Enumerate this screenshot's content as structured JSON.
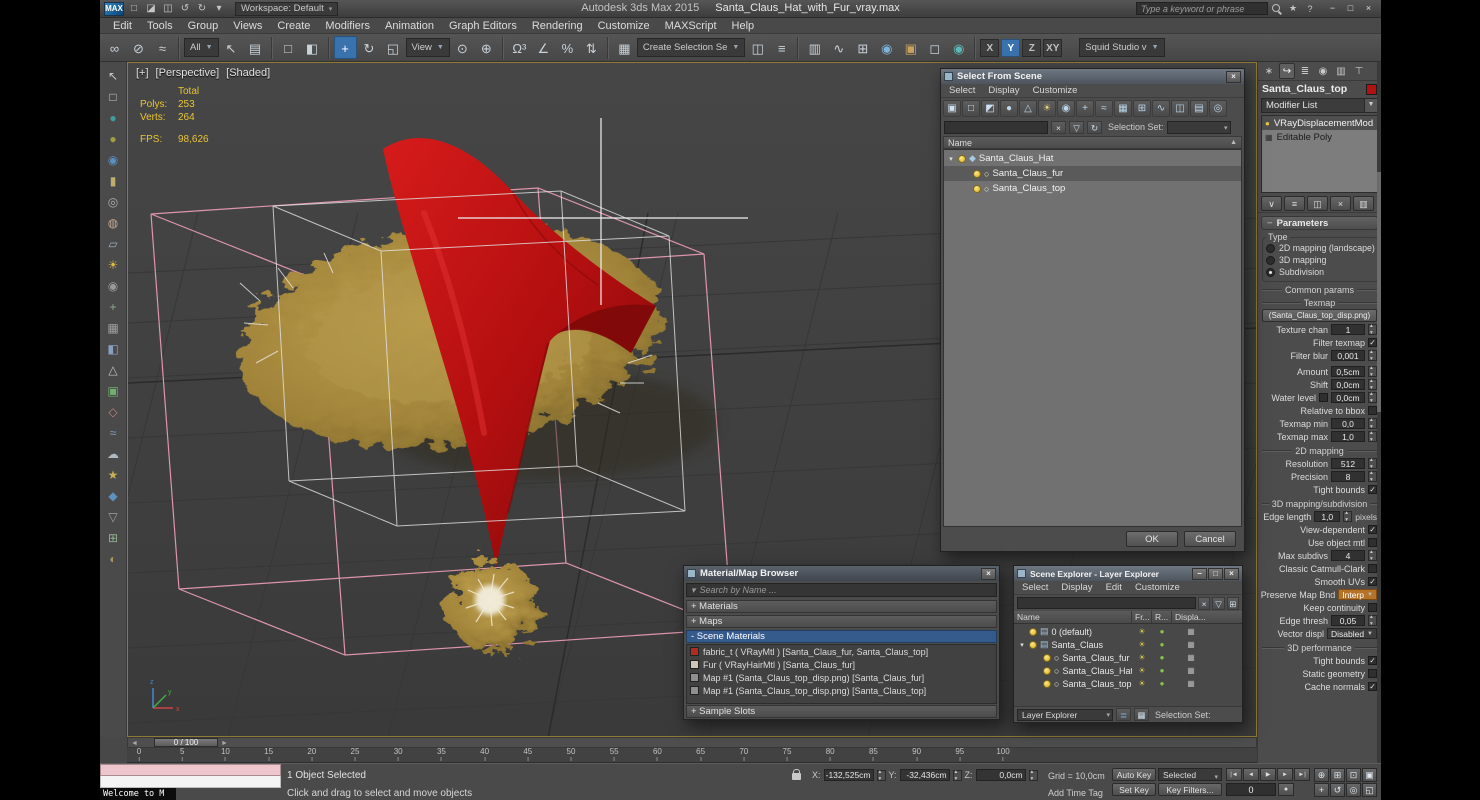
{
  "window": {
    "logo": "MAX",
    "title_app": "Autodesk 3ds Max  2015",
    "title_file": "Santa_Claus_Hat_with_Fur_vray.max",
    "search_placeholder": "Type a keyword or phrase",
    "workspace_label": "Workspace: Default",
    "workspace_arrow": "▾",
    "qat_icons": [
      {
        "name": "new-scene-icon",
        "glyph": "□"
      },
      {
        "name": "open-file-icon",
        "glyph": "◪"
      },
      {
        "name": "save-file-icon",
        "glyph": "◫"
      },
      {
        "name": "undo-icon",
        "glyph": "↺"
      },
      {
        "name": "redo-icon",
        "glyph": "↻"
      },
      {
        "name": "project-folder-icon",
        "glyph": "▾"
      }
    ],
    "help_icon": "?",
    "favorites_icon": "★",
    "controls": [
      {
        "name": "minimize-button",
        "glyph": "−"
      },
      {
        "name": "maximize-button",
        "glyph": "□"
      },
      {
        "name": "close-button",
        "glyph": "×"
      }
    ]
  },
  "menus": [
    "Edit",
    "Tools",
    "Group",
    "Views",
    "Create",
    "Modifiers",
    "Animation",
    "Graph Editors",
    "Rendering",
    "Customize",
    "MAXScript",
    "Help"
  ],
  "toolbar": {
    "g1": [
      {
        "name": "select-and-link-icon",
        "glyph": "∞"
      },
      {
        "name": "unlink-selection-icon",
        "glyph": "⊘"
      },
      {
        "name": "bind-to-space-warp-icon",
        "glyph": "≈"
      }
    ],
    "filter_dropdown": "All",
    "g2": [
      {
        "name": "select-object-icon",
        "glyph": "↖"
      },
      {
        "name": "select-by-name-icon",
        "glyph": "▤"
      }
    ],
    "g3": [
      {
        "name": "selection-region-icon",
        "glyph": "□"
      },
      {
        "name": "window-crossing-icon",
        "glyph": "◧"
      }
    ],
    "g4": [
      {
        "name": "select-and-move-icon",
        "glyph": "+",
        "active": true
      },
      {
        "name": "select-and-rotate-icon",
        "glyph": "↻"
      },
      {
        "name": "select-and-scale-icon",
        "glyph": "◱"
      }
    ],
    "refcoord_dropdown": "View",
    "g5": [
      {
        "name": "use-pivot-point-icon",
        "glyph": "⊙"
      },
      {
        "name": "select-and-manipulate-icon",
        "glyph": "⊕"
      }
    ],
    "g6": [
      {
        "name": "snap-toggle-icon",
        "glyph": "Ω³"
      },
      {
        "name": "angle-snap-icon",
        "glyph": "∠"
      },
      {
        "name": "percent-snap-icon",
        "glyph": "%"
      },
      {
        "name": "spinner-snap-icon",
        "glyph": "⇅"
      }
    ],
    "g7": [
      {
        "name": "edit-named-selection-sets-icon",
        "glyph": "▦"
      }
    ],
    "namedsel_dropdown": "Create Selection Se",
    "g8": [
      {
        "name": "mirror-icon",
        "glyph": "◫"
      },
      {
        "name": "align-icon",
        "glyph": "≡"
      }
    ],
    "g9": [
      {
        "name": "layer-manager-icon",
        "glyph": "▥"
      },
      {
        "name": "curve-editor-icon",
        "glyph": "∿"
      },
      {
        "name": "schematic-view-icon",
        "glyph": "⊞"
      },
      {
        "name": "material-editor-icon",
        "glyph": "◉",
        "color": "#7fb2d9"
      },
      {
        "name": "render-setup-icon",
        "glyph": "▣",
        "color": "#c9a25e"
      },
      {
        "name": "rendered-frame-icon",
        "glyph": "◻"
      },
      {
        "name": "render-production-icon",
        "glyph": "◉",
        "color": "#5fb8b8"
      }
    ],
    "axis": [
      {
        "name": "axis-x-button",
        "label": "X"
      },
      {
        "name": "axis-y-button",
        "label": "Y",
        "active": true
      },
      {
        "name": "axis-z-button",
        "label": "Z"
      },
      {
        "name": "axis-xy-button",
        "label": "XY"
      }
    ],
    "preset_dropdown": "Squid Studio v"
  },
  "left_icons": [
    {
      "name": "select-cursor-icon",
      "glyph": "↖",
      "color": "#c9c9c9"
    },
    {
      "name": "marquee-icon",
      "glyph": "□",
      "color": "#c9c9c9"
    },
    {
      "name": "sphere-teal-icon",
      "glyph": "●",
      "color": "#3f9f9f"
    },
    {
      "name": "sphere-olive-icon",
      "glyph": "●",
      "color": "#9f9f3f"
    },
    {
      "name": "geosphere-icon",
      "glyph": "◉",
      "color": "#5a8fbf"
    },
    {
      "name": "cylinder-icon",
      "glyph": "▮",
      "color": "#bfae6a"
    },
    {
      "name": "torus-icon",
      "glyph": "◎",
      "color": "#b0b0b0"
    },
    {
      "name": "teapot-icon",
      "glyph": "◍",
      "color": "#c8a890"
    },
    {
      "name": "plane-icon",
      "glyph": "▱",
      "color": "#99aabb"
    },
    {
      "name": "light-icon",
      "glyph": "☀",
      "color": "#e0c040"
    },
    {
      "name": "camera-icon",
      "glyph": "◉",
      "color": "#9a9a9a"
    },
    {
      "name": "helper-icon",
      "glyph": "+",
      "color": "#8ab08a"
    },
    {
      "name": "grid-object-icon",
      "glyph": "▦",
      "color": "#a0a0a0"
    },
    {
      "name": "split-view-icon",
      "glyph": "◧",
      "color": "#88a0c0"
    },
    {
      "name": "triangle-icon",
      "glyph": "△",
      "color": "#c0c0c0"
    },
    {
      "name": "box-green-icon",
      "glyph": "▣",
      "color": "#70b070"
    },
    {
      "name": "diamond-icon",
      "glyph": "◇",
      "color": "#c08080"
    },
    {
      "name": "wave-icon",
      "glyph": "≈",
      "color": "#80a0c0"
    },
    {
      "name": "cloud-icon",
      "glyph": "☁",
      "color": "#b0b8c0"
    },
    {
      "name": "star-icon",
      "glyph": "★",
      "color": "#c8b050"
    },
    {
      "name": "gem-icon",
      "glyph": "◆",
      "color": "#6090c0"
    },
    {
      "name": "cone-icon",
      "glyph": "▽",
      "color": "#a0a0a0"
    },
    {
      "name": "patch-icon",
      "glyph": "⊞",
      "color": "#90b090"
    },
    {
      "name": "half-sphere-icon",
      "glyph": "◐",
      "color": "#b09060"
    }
  ],
  "viewport": {
    "label_plus": "[+]",
    "label_view": "[Perspective]",
    "label_shading": "[Shaded]",
    "stats": {
      "total_label": "Total",
      "polys_label": "Polys:",
      "polys": "253",
      "verts_label": "Verts:",
      "verts": "264",
      "fps_label": "FPS:",
      "fps": "98,626"
    }
  },
  "select_from_scene": {
    "title": "Select From Scene",
    "close": "×",
    "menus": [
      "Select",
      "Display",
      "Customize"
    ],
    "toolbar_icons": [
      {
        "name": "display-all-icon",
        "glyph": "▣",
        "color": "#cfe2f3"
      },
      {
        "name": "display-none-icon",
        "glyph": "□",
        "color": "#cfe2f3"
      },
      {
        "name": "display-invert-icon",
        "glyph": "◩",
        "color": "#cfe2f3"
      },
      {
        "name": "display-geometry-icon",
        "glyph": "●",
        "color": "#bcd6ea"
      },
      {
        "name": "display-shapes-icon",
        "glyph": "△",
        "color": "#bcd6ea"
      },
      {
        "name": "display-lights-icon",
        "glyph": "☀",
        "color": "#e6d27a"
      },
      {
        "name": "display-cameras-icon",
        "glyph": "◉",
        "color": "#bcd6ea"
      },
      {
        "name": "display-helpers-icon",
        "glyph": "+",
        "color": "#bcd6ea"
      },
      {
        "name": "display-spacewarps-icon",
        "glyph": "≈",
        "color": "#bcd6ea"
      },
      {
        "name": "display-groups-icon",
        "glyph": "▦",
        "color": "#bcd6ea"
      },
      {
        "name": "display-xrefs-icon",
        "glyph": "⊞",
        "color": "#bcd6ea"
      },
      {
        "name": "display-bones-icon",
        "glyph": "∿",
        "color": "#bcd6ea"
      },
      {
        "name": "display-containers-icon",
        "glyph": "◫",
        "color": "#bcd6ea"
      },
      {
        "name": "display-children-icon",
        "glyph": "▤",
        "color": "#bcd6ea"
      },
      {
        "name": "display-influences-icon",
        "glyph": "◎",
        "color": "#bcd6ea"
      }
    ],
    "clear_icon": "×",
    "filter_icon": "▽",
    "sync_icon": "↻",
    "selection_set_label": "Selection Set:",
    "name_header": "Name",
    "sort_icon": "▲",
    "tree": [
      {
        "name": "tree-row-santa-claus-hat",
        "label": "Santa_Claus_Hat",
        "exp": "▾",
        "shape": "◆",
        "shapecolor": "#a8c8e8",
        "level": 0
      },
      {
        "name": "tree-row-santa-claus-fur",
        "label": "Santa_Claus_fur",
        "exp": "",
        "shape": "○",
        "shapecolor": "#ececec",
        "level": 1,
        "selected": true
      },
      {
        "name": "tree-row-santa-claus-top",
        "label": "Santa_Claus_top",
        "exp": "",
        "shape": "○",
        "shapecolor": "#ececec",
        "level": 1
      }
    ],
    "ok": "OK",
    "cancel": "Cancel"
  },
  "material_browser": {
    "title": "Material/Map Browser",
    "close": "×",
    "search_arrow": "▾",
    "search_placeholder": "Search by Name ...",
    "materials_bar": "+ Materials",
    "maps_bar": "+ Maps",
    "scene_materials_bar": "- Scene Materials",
    "sample_slots_bar": "+ Sample Slots",
    "items": [
      {
        "name": "material-fabric-t",
        "label": "fabric_t ( VRayMtl ) [Santa_Claus_fur, Santa_Claus_top]",
        "swatch": "#b02c22"
      },
      {
        "name": "material-fur",
        "label": "Fur ( VRayHairMtl ) [Santa_Claus_fur]",
        "swatch": "#cfc8b8"
      },
      {
        "name": "map-1-santa-claus-fur",
        "label": "Map #1 (Santa_Claus_top_disp.png) [Santa_Claus_fur]",
        "swatch": "#8f8f8f"
      },
      {
        "name": "map-1-santa-claus-top",
        "label": "Map #1 (Santa_Claus_top_disp.png) [Santa_Claus_top]",
        "swatch": "#8f8f8f"
      }
    ]
  },
  "scene_explorer": {
    "title": "Scene Explorer - Layer Explorer",
    "menus": [
      "Select",
      "Display",
      "Edit",
      "Customize"
    ],
    "clear_icon": "×",
    "filter_icon": "▽",
    "link_icon": "⊞",
    "columns": [
      "Name",
      "Fr...",
      "R...",
      "Displa..."
    ],
    "rows": [
      {
        "name": "explorer-row-default-layer",
        "label": "0 (default)",
        "exp": "",
        "shape": "▤",
        "shapecolor": "#9fc0dd",
        "pad": "4px",
        "fr": "☀",
        "r": "●",
        "d": "▦"
      },
      {
        "name": "explorer-row-santa-claus",
        "label": "Santa_Claus",
        "exp": "▾",
        "shape": "▤",
        "shapecolor": "#9fc0dd",
        "pad": "4px",
        "fr": "☀",
        "r": "●",
        "d": "▦"
      },
      {
        "name": "explorer-row-santa-claus-fur",
        "label": "Santa_Claus_fur",
        "exp": "",
        "shape": "○",
        "shapecolor": "#ececec",
        "pad": "18px",
        "fr": "☀",
        "r": "●",
        "d": "▦"
      },
      {
        "name": "explorer-row-santa-claus-hat",
        "label": "Santa_Claus_Hat",
        "exp": "",
        "shape": "○",
        "shapecolor": "#ececec",
        "pad": "18px",
        "fr": "☀",
        "r": "●",
        "d": "▦"
      },
      {
        "name": "explorer-row-santa-claus-top",
        "label": "Santa_Claus_top",
        "exp": "",
        "shape": "○",
        "shapecolor": "#ececec",
        "pad": "18px",
        "fr": "☀",
        "r": "●",
        "d": "▦"
      }
    ],
    "footer_dropdown": "Layer Explorer",
    "selection_set_label": "Selection Set:"
  },
  "cp": {
    "tabs": [
      {
        "name": "create-tab-icon",
        "glyph": "∗"
      },
      {
        "name": "modify-tab-icon",
        "glyph": "↪",
        "active": true
      },
      {
        "name": "hierarchy-tab-icon",
        "glyph": "≣"
      },
      {
        "name": "motion-tab-icon",
        "glyph": "◉"
      },
      {
        "name": "display-tab-icon",
        "glyph": "▥"
      },
      {
        "name": "utilities-tab-icon",
        "glyph": "⊤"
      }
    ],
    "object_name": "Santa_Claus_top",
    "modifier_list_label": "Modifier List",
    "stack": [
      {
        "name": "stack-item-vraydisplacementmod",
        "label": "VRayDisplacementMod",
        "selected": true,
        "icon": "●",
        "iconcolor": "#e8c545"
      },
      {
        "name": "stack-item-editable-poly",
        "label": "Editable Poly",
        "icon": "▦",
        "iconcolor": "#2e2e2e"
      }
    ],
    "stack_buttons": [
      {
        "name": "pin-stack-button",
        "glyph": "∨"
      },
      {
        "name": "show-end-result-button",
        "glyph": "≡"
      },
      {
        "name": "make-unique-button",
        "glyph": "◫"
      },
      {
        "name": "remove-modifier-button",
        "glyph": "×"
      },
      {
        "name": "configure-modifier-sets-button",
        "glyph": "▥"
      }
    ],
    "parameters_title": "Parameters",
    "rollout_minus": "−",
    "type_legend": "Type",
    "type_options": [
      {
        "name": "radio-2d-mapping",
        "label": "2D mapping (landscape)"
      },
      {
        "name": "radio-3d-mapping",
        "label": "3D mapping"
      },
      {
        "name": "radio-subdivision",
        "label": "Subdivision",
        "selected": true
      }
    ],
    "seps": {
      "common": "Common params",
      "texmap": "Texmap",
      "d2": "2D mapping",
      "d3": "3D mapping/subdivision",
      "perf": "3D performance"
    },
    "texmap_button": "(Santa_Claus_top_disp.png)",
    "p": {
      "texture_chan": {
        "label": "Texture chan",
        "value": "1"
      },
      "filter_texmap": {
        "label": "Filter texmap",
        "check": "✓"
      },
      "filter_blur": {
        "label": "Filter blur",
        "value": "0,001"
      },
      "amount": {
        "label": "Amount",
        "value": "0,5cm"
      },
      "shift": {
        "label": "Shift",
        "value": "0,0cm"
      },
      "water_level": {
        "label": "Water level",
        "check": "",
        "value": "0,0cm"
      },
      "relative_bbox": {
        "label": "Relative to bbox",
        "check": ""
      },
      "texmap_min": {
        "label": "Texmap min",
        "value": "0,0"
      },
      "texmap_max": {
        "label": "Texmap max",
        "value": "1,0"
      },
      "resolution": {
        "label": "Resolution",
        "value": "512"
      },
      "precision": {
        "label": "Precision",
        "value": "8"
      },
      "tight_bounds_2d": {
        "label": "Tight bounds",
        "check": "✓"
      },
      "edge_length": {
        "label": "Edge length",
        "value": "1,0",
        "unit": "pixels"
      },
      "view_dependent": {
        "label": "View-dependent",
        "check": "✓"
      },
      "use_object_mtl": {
        "label": "Use object mtl",
        "check": ""
      },
      "max_subdivs": {
        "label": "Max subdivs",
        "value": "4"
      },
      "classic_cc": {
        "label": "Classic Catmull-Clark",
        "check": ""
      },
      "smooth_uvs": {
        "label": "Smooth UVs",
        "check": "✓"
      },
      "preserve_map_bnd": {
        "label": "Preserve Map Bnd",
        "value": "Interp"
      },
      "keep_continuity": {
        "label": "Keep continuity",
        "check": ""
      },
      "edge_thresh": {
        "label": "Edge thresh",
        "value": "0,05"
      },
      "vector_displ": {
        "label": "Vector displ",
        "value": "Disabled"
      },
      "tight_bounds_3d": {
        "label": "Tight bounds",
        "check": "✓"
      },
      "static_geometry": {
        "label": "Static geometry",
        "check": ""
      },
      "cache_normals": {
        "label": "Cache normals",
        "check": "✓"
      }
    }
  },
  "timeline": {
    "slider_label": "0 / 100",
    "left_arrow": "◄",
    "right_arrow": "►",
    "ticks": [
      0,
      5,
      10,
      15,
      20,
      25,
      30,
      35,
      40,
      45,
      50,
      55,
      60,
      65,
      70,
      75,
      80,
      85,
      90,
      95,
      100
    ]
  },
  "status": {
    "welcome": "Welcome to M",
    "selection_status": "1 Object Selected",
    "prompt": "Click and drag to select and move objects",
    "x_label": "X:",
    "x_value": "-132,525cm",
    "y_label": "Y:",
    "y_value": "-32,436cm",
    "z_label": "Z:",
    "z_value": "0,0cm",
    "grid_label": "Grid = 10,0cm",
    "add_time_tag": "Add Time Tag",
    "auto_key": "Auto Key",
    "set_key": "Set Key",
    "selected_dropdown": "Selected",
    "key_filters": "Key Filters...",
    "frame_field": "0",
    "key_mode_icon": "●",
    "transport": [
      {
        "name": "go-to-start-button",
        "glyph": "|◄"
      },
      {
        "name": "previous-frame-button",
        "glyph": "◄"
      },
      {
        "name": "play-animation-button",
        "glyph": "▶"
      },
      {
        "name": "next-frame-button",
        "glyph": "►"
      },
      {
        "name": "go-to-end-button",
        "glyph": "►|"
      }
    ],
    "nav": [
      {
        "name": "zoom-icon",
        "glyph": "⊕"
      },
      {
        "name": "zoom-all-icon",
        "glyph": "⊞"
      },
      {
        "name": "zoom-extents-icon",
        "glyph": "⊡"
      },
      {
        "name": "zoom-region-icon",
        "glyph": "▣"
      },
      {
        "name": "pan-icon",
        "glyph": "+"
      },
      {
        "name": "orbit-icon",
        "glyph": "↺"
      },
      {
        "name": "field-of-view-icon",
        "glyph": "◎"
      },
      {
        "name": "maximize-viewport-icon",
        "glyph": "◱"
      }
    ]
  }
}
